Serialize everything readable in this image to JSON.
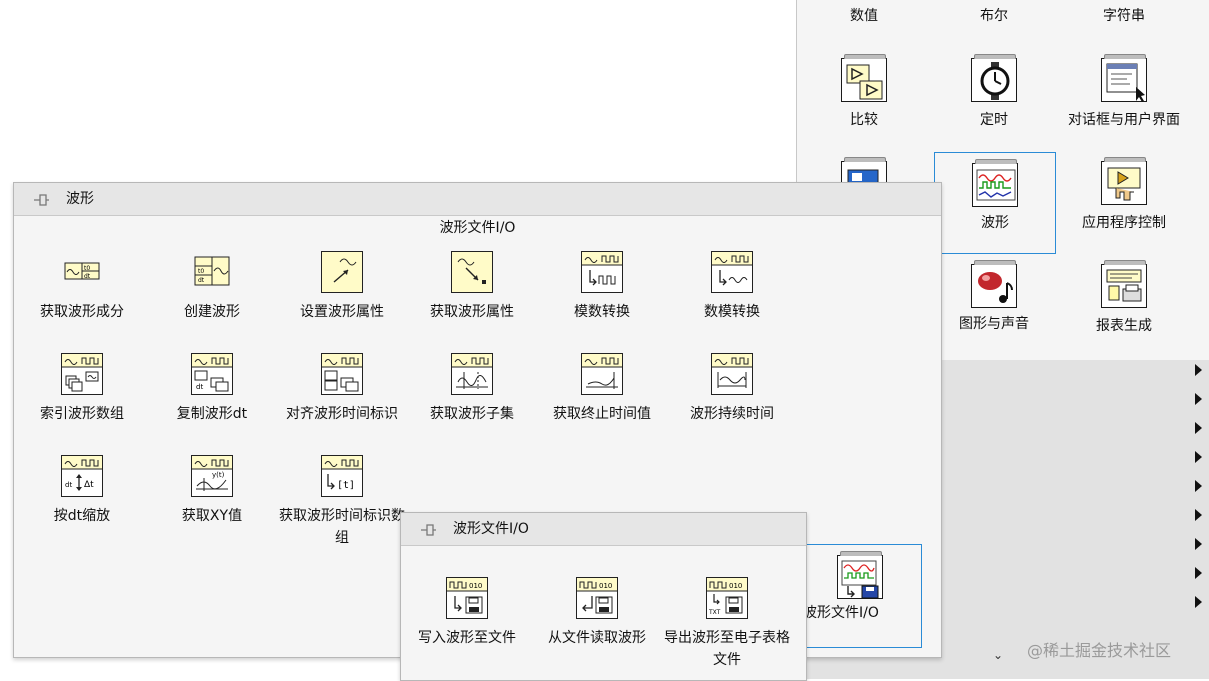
{
  "main_palette": {
    "items": [
      {
        "label": "数值",
        "icon": "numeric-icon"
      },
      {
        "label": "布尔",
        "icon": "boolean-icon"
      },
      {
        "label": "字符串",
        "icon": "string-icon"
      },
      {
        "label": "比较",
        "icon": "comparison-icon"
      },
      {
        "label": "定时",
        "icon": "timing-icon"
      },
      {
        "label": "对话框与用户界面",
        "icon": "dialog-ui-icon"
      },
      {
        "label": "",
        "icon": "array-icon"
      },
      {
        "label": "波形",
        "icon": "waveform-icon",
        "selected": true
      },
      {
        "label": "应用程序控制",
        "icon": "app-control-icon"
      },
      {
        "label": "图形与声音",
        "icon": "graphics-sound-icon"
      },
      {
        "label": "报表生成",
        "icon": "report-icon"
      }
    ],
    "waveform_file_io": {
      "label": "波形文件I/O",
      "icon": "waveform-file-io-icon"
    }
  },
  "waveform_palette": {
    "title": "波形",
    "category_header": "波形文件I/O",
    "items": [
      {
        "label": "获取波形成分"
      },
      {
        "label": "创建波形"
      },
      {
        "label": "设置波形属性"
      },
      {
        "label": "获取波形属性"
      },
      {
        "label": "模数转换"
      },
      {
        "label": "数模转换"
      },
      {
        "label": "索引波形数组"
      },
      {
        "label": "复制波形dt"
      },
      {
        "label": "对齐波形时间标识"
      },
      {
        "label": "获取波形子集"
      },
      {
        "label": "获取终止时间值"
      },
      {
        "label": "波形持续时间"
      },
      {
        "label": "按dt缩放"
      },
      {
        "label": "获取XY值"
      },
      {
        "label": "获取波形时间标识数组"
      }
    ]
  },
  "file_io_palette": {
    "title": "波形文件I/O",
    "items": [
      {
        "label": "写入波形至文件"
      },
      {
        "label": "从文件读取波形"
      },
      {
        "label": "导出波形至电子表格文件"
      }
    ]
  },
  "icon_text": {
    "dt": "dt",
    "t0": "t0",
    "bracket_t": "[t]",
    "yt": "y(t)",
    "txt": "TXT",
    "io_bits": "010",
    "delta_t": "Δt"
  },
  "chevron": "⌄",
  "watermark": "@稀土掘金技术社区",
  "colors": {
    "selection": "#2a8bd6",
    "icon_bg": "#ffffff",
    "tile_yellow": "#fffbc8"
  }
}
